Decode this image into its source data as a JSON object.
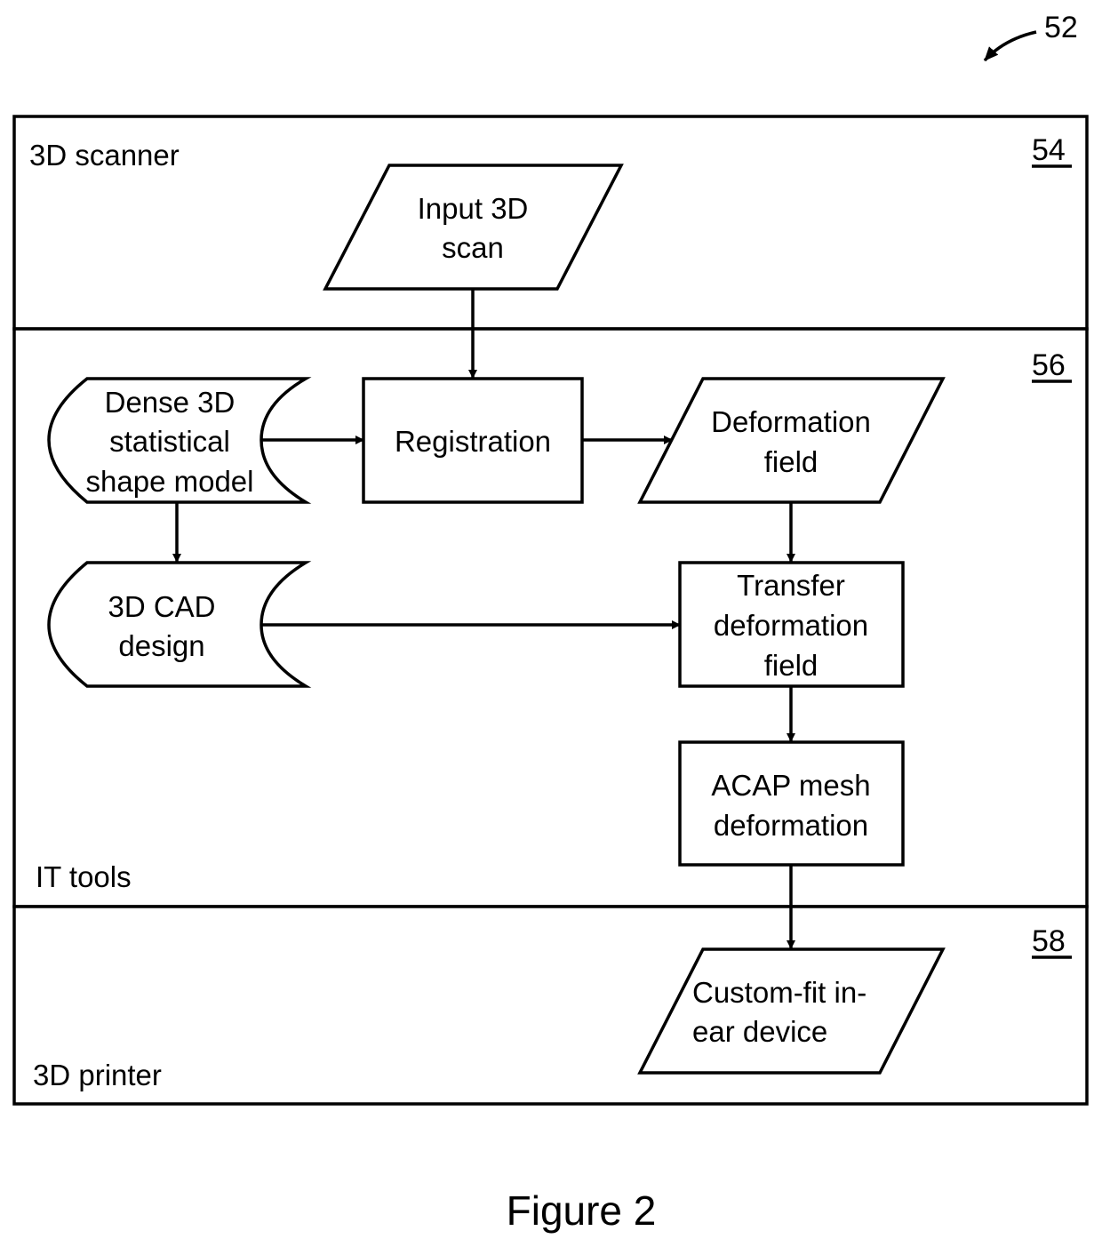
{
  "figure": {
    "caption": "Figure 2",
    "ref_number": "52"
  },
  "lanes": [
    {
      "id": "scanner",
      "label": "3D scanner",
      "ref": "54"
    },
    {
      "id": "it",
      "label": "IT tools",
      "ref": "56"
    },
    {
      "id": "printer",
      "label": "3D printer",
      "ref": "58"
    }
  ],
  "nodes": {
    "input_scan": {
      "shape": "data",
      "lines": [
        "Input 3D",
        "scan"
      ]
    },
    "ssm": {
      "shape": "stored-data",
      "lines": [
        "Dense 3D",
        "statistical",
        "shape model"
      ]
    },
    "registration": {
      "shape": "process",
      "lines": [
        "Registration"
      ]
    },
    "deformation_field": {
      "shape": "data",
      "lines": [
        "Deformation",
        "field"
      ]
    },
    "cad": {
      "shape": "stored-data",
      "lines": [
        "3D CAD",
        "design"
      ]
    },
    "transfer": {
      "shape": "process",
      "lines": [
        "Transfer",
        "deformation",
        "field"
      ]
    },
    "acap": {
      "shape": "process",
      "lines": [
        "ACAP mesh",
        "deformation"
      ]
    },
    "device": {
      "shape": "data",
      "lines": [
        "Custom-fit in-",
        "ear device"
      ]
    }
  },
  "edges": [
    {
      "from": "input_scan",
      "to": "registration"
    },
    {
      "from": "ssm",
      "to": "registration"
    },
    {
      "from": "registration",
      "to": "deformation_field"
    },
    {
      "from": "ssm",
      "to": "cad"
    },
    {
      "from": "deformation_field",
      "to": "transfer"
    },
    {
      "from": "cad",
      "to": "transfer"
    },
    {
      "from": "transfer",
      "to": "acap"
    },
    {
      "from": "acap",
      "to": "device"
    }
  ]
}
